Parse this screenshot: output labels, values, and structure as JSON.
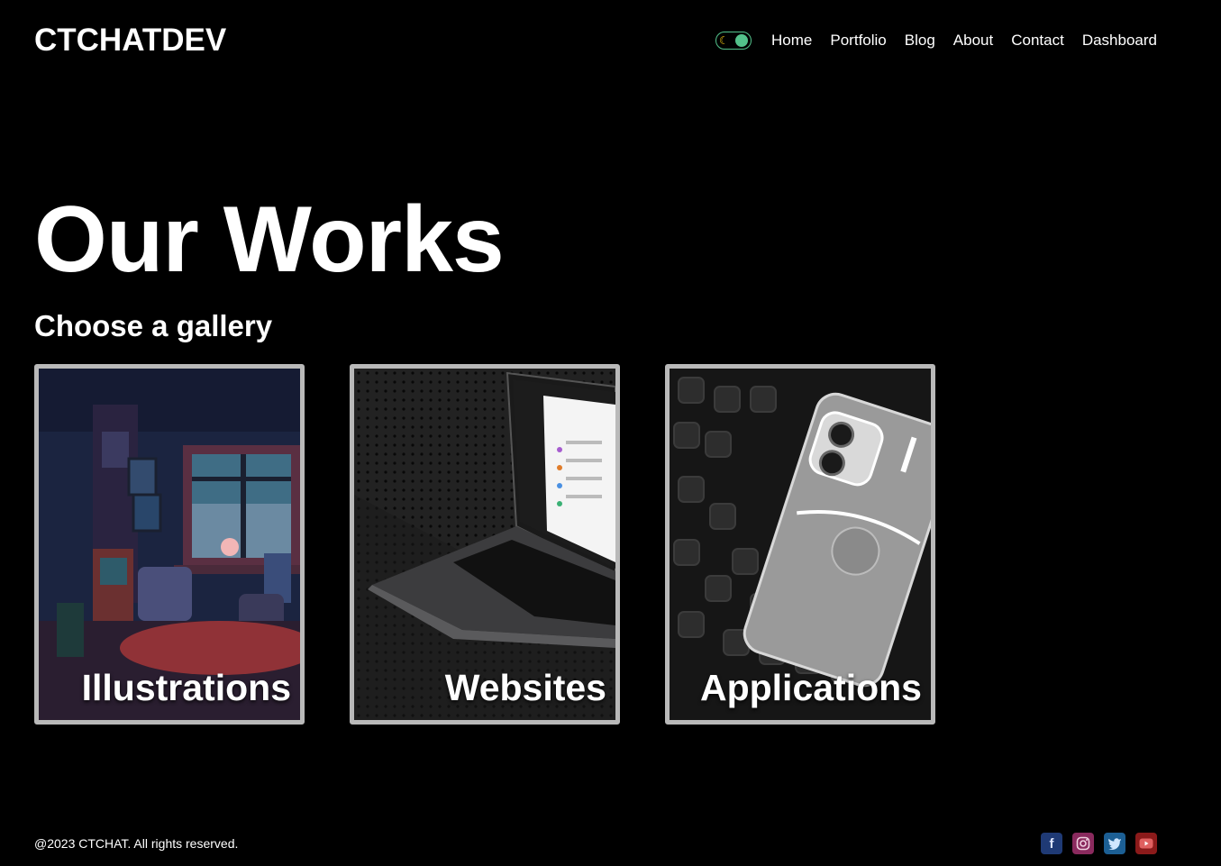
{
  "header": {
    "logo": "CTCHATDEV",
    "theme_toggle": {
      "icon_left": "moon-icon",
      "state": "dark"
    },
    "nav": [
      {
        "label": "Home"
      },
      {
        "label": "Portfolio"
      },
      {
        "label": "Blog"
      },
      {
        "label": "About"
      },
      {
        "label": "Contact"
      },
      {
        "label": "Dashboard"
      }
    ]
  },
  "main": {
    "title": "Our Works",
    "subtitle": "Choose a gallery",
    "galleries": [
      {
        "label": "Illustrations",
        "image": "pixel-art-room-image"
      },
      {
        "label": "Websites",
        "image": "laptop-image"
      },
      {
        "label": "Applications",
        "image": "phone-image"
      }
    ]
  },
  "footer": {
    "copyright": "@2023 CTCHAT. All rights reserved.",
    "social": [
      {
        "icon": "facebook-icon",
        "color": "#1f3a75"
      },
      {
        "icon": "instagram-icon",
        "color": "#8a2a5e"
      },
      {
        "icon": "twitter-icon",
        "color": "#1c5f94"
      },
      {
        "icon": "youtube-icon",
        "color": "#8b1a1a"
      }
    ]
  },
  "colors": {
    "background": "#000000",
    "text": "#ffffff",
    "toggle_accent": "#53c28b",
    "card_border": "#b9b9b9"
  }
}
